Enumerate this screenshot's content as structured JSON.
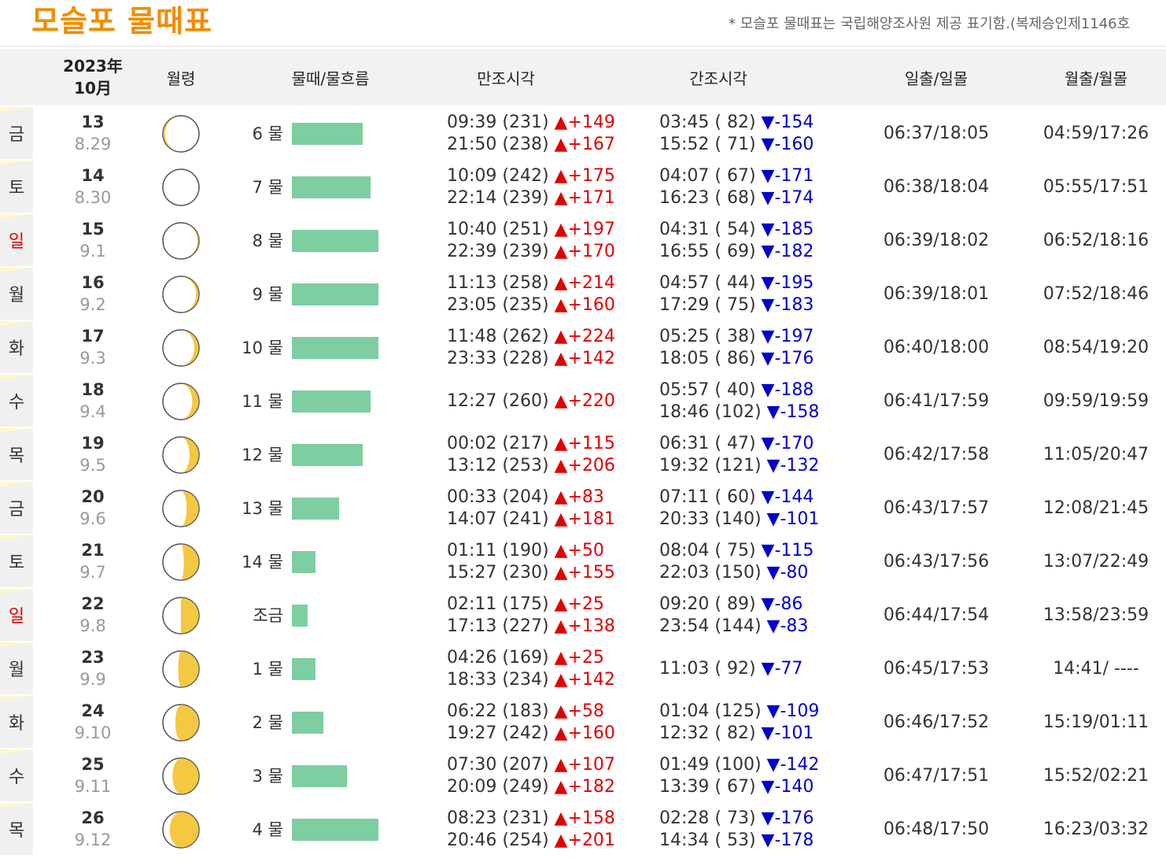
{
  "title": "모슬포 물때표",
  "note": "* 모슬포 물때표는 국립해양조사원 제공 표기함.(복제승인제1146호",
  "header": {
    "year_month": [
      "2023年",
      "10月"
    ],
    "moon_age": "월령",
    "tide": "물때/물흐름",
    "high": "만조시각",
    "low": "간조시각",
    "sun": "일출/일몰",
    "moon": "월출/월몰"
  },
  "colors": {
    "title": "#f28c00",
    "bar": "#7dcea0",
    "high": "#e00000",
    "low": "#0000cc",
    "sunday": "#e00000",
    "moon_lit": "#f5c842"
  },
  "rows": [
    {
      "dow": "금",
      "day": "13",
      "lunar": "8.29",
      "tide": "6 물",
      "flow": 45,
      "lit": 0.05,
      "waxing": false,
      "high": [
        [
          "09:39 (231) ",
          "▲+149"
        ],
        [
          "21:50 (238) ",
          "▲+167"
        ]
      ],
      "low": [
        [
          "03:45 ( 82) ",
          "▼-154"
        ],
        [
          "15:52 ( 71) ",
          "▼-160"
        ]
      ],
      "sun": "06:37/18:05",
      "moonrs": "04:59/17:26"
    },
    {
      "dow": "토",
      "day": "14",
      "lunar": "8.30",
      "tide": "7 물",
      "flow": 50,
      "lit": 0.0,
      "waxing": true,
      "high": [
        [
          "10:09 (242) ",
          "▲+175"
        ],
        [
          "22:14 (239) ",
          "▲+171"
        ]
      ],
      "low": [
        [
          "04:07 ( 67) ",
          "▼-171"
        ],
        [
          "16:23 ( 68) ",
          "▼-174"
        ]
      ],
      "sun": "06:38/18:04",
      "moonrs": "05:55/17:51"
    },
    {
      "dow": "일",
      "day": "15",
      "lunar": "9.1",
      "tide": "8 물",
      "flow": 55,
      "lit": 0.03,
      "waxing": true,
      "sunday": true,
      "high": [
        [
          "10:40 (251) ",
          "▲+197"
        ],
        [
          "22:39 (239) ",
          "▲+170"
        ]
      ],
      "low": [
        [
          "04:31 ( 54) ",
          "▼-185"
        ],
        [
          "16:55 ( 69) ",
          "▼-182"
        ]
      ],
      "sun": "06:39/18:02",
      "moonrs": "06:52/18:16"
    },
    {
      "dow": "월",
      "day": "16",
      "lunar": "9.2",
      "tide": "9 물",
      "flow": 55,
      "lit": 0.07,
      "waxing": true,
      "high": [
        [
          "11:13 (258) ",
          "▲+214"
        ],
        [
          "23:05 (235) ",
          "▲+160"
        ]
      ],
      "low": [
        [
          "04:57 ( 44) ",
          "▼-195"
        ],
        [
          "17:29 ( 75) ",
          "▼-183"
        ]
      ],
      "sun": "06:39/18:01",
      "moonrs": "07:52/18:46"
    },
    {
      "dow": "화",
      "day": "17",
      "lunar": "9.3",
      "tide": "10 물",
      "flow": 55,
      "lit": 0.12,
      "waxing": true,
      "high": [
        [
          "11:48 (262) ",
          "▲+224"
        ],
        [
          "23:33 (228) ",
          "▲+142"
        ]
      ],
      "low": [
        [
          "05:25 ( 38) ",
          "▼-197"
        ],
        [
          "18:05 ( 86) ",
          "▼-176"
        ]
      ],
      "sun": "06:40/18:00",
      "moonrs": "08:54/19:20"
    },
    {
      "dow": "수",
      "day": "18",
      "lunar": "9.4",
      "tide": "11 물",
      "flow": 50,
      "lit": 0.18,
      "waxing": true,
      "high": [
        [
          "12:27 (260) ",
          "▲+220"
        ]
      ],
      "low": [
        [
          "05:57 ( 40) ",
          "▼-188"
        ],
        [
          "18:46 (102) ",
          "▼-158"
        ]
      ],
      "sun": "06:41/17:59",
      "moonrs": "09:59/19:59"
    },
    {
      "dow": "목",
      "day": "19",
      "lunar": "9.5",
      "tide": "12 물",
      "flow": 45,
      "lit": 0.26,
      "waxing": true,
      "high": [
        [
          "00:02 (217) ",
          "▲+115"
        ],
        [
          "13:12 (253) ",
          "▲+206"
        ]
      ],
      "low": [
        [
          "06:31 ( 47) ",
          "▼-170"
        ],
        [
          "19:32 (121) ",
          "▼-132"
        ]
      ],
      "sun": "06:42/17:58",
      "moonrs": "11:05/20:47"
    },
    {
      "dow": "금",
      "day": "20",
      "lunar": "9.6",
      "tide": "13 물",
      "flow": 30,
      "lit": 0.34,
      "waxing": true,
      "high": [
        [
          "00:33 (204) ",
          "▲+83"
        ],
        [
          "14:07 (241) ",
          "▲+181"
        ]
      ],
      "low": [
        [
          "07:11 ( 60) ",
          "▼-144"
        ],
        [
          "20:33 (140) ",
          "▼-101"
        ]
      ],
      "sun": "06:43/17:57",
      "moonrs": "12:08/21:45"
    },
    {
      "dow": "토",
      "day": "21",
      "lunar": "9.7",
      "tide": "14 물",
      "flow": 15,
      "lit": 0.42,
      "waxing": true,
      "high": [
        [
          "01:11 (190) ",
          "▲+50"
        ],
        [
          "15:27 (230) ",
          "▲+155"
        ]
      ],
      "low": [
        [
          "08:04 ( 75) ",
          "▼-115"
        ],
        [
          "22:03 (150) ",
          "▼-80"
        ]
      ],
      "sun": "06:43/17:56",
      "moonrs": "13:07/22:49"
    },
    {
      "dow": "일",
      "day": "22",
      "lunar": "9.8",
      "tide": "조금",
      "flow": 10,
      "lit": 0.5,
      "waxing": true,
      "sunday": true,
      "high": [
        [
          "02:11 (175) ",
          "▲+25"
        ],
        [
          "17:13 (227) ",
          "▲+138"
        ]
      ],
      "low": [
        [
          "09:20 ( 89) ",
          "▼-86"
        ],
        [
          "23:54 (144) ",
          "▼-83"
        ]
      ],
      "sun": "06:44/17:54",
      "moonrs": "13:58/23:59"
    },
    {
      "dow": "월",
      "day": "23",
      "lunar": "9.9",
      "tide": "1 물",
      "flow": 15,
      "lit": 0.58,
      "waxing": true,
      "high": [
        [
          "04:26 (169) ",
          "▲+25"
        ],
        [
          "18:33 (234) ",
          "▲+142"
        ]
      ],
      "low": [
        [
          "11:03 ( 92) ",
          "▼-77"
        ]
      ],
      "sun": "06:45/17:53",
      "moonrs": "14:41/ ----"
    },
    {
      "dow": "화",
      "day": "24",
      "lunar": "9.10",
      "tide": "2 물",
      "flow": 20,
      "lit": 0.66,
      "waxing": true,
      "high": [
        [
          "06:22 (183) ",
          "▲+58"
        ],
        [
          "19:27 (242) ",
          "▲+160"
        ]
      ],
      "low": [
        [
          "01:04 (125) ",
          "▼-109"
        ],
        [
          "12:32 ( 82) ",
          "▼-101"
        ]
      ],
      "sun": "06:46/17:52",
      "moonrs": "15:19/01:11"
    },
    {
      "dow": "수",
      "day": "25",
      "lunar": "9.11",
      "tide": "3 물",
      "flow": 35,
      "lit": 0.74,
      "waxing": true,
      "high": [
        [
          "07:30 (207) ",
          "▲+107"
        ],
        [
          "20:09 (249) ",
          "▲+182"
        ]
      ],
      "low": [
        [
          "01:49 (100) ",
          "▼-142"
        ],
        [
          "13:39 ( 67) ",
          "▼-140"
        ]
      ],
      "sun": "06:47/17:51",
      "moonrs": "15:52/02:21"
    },
    {
      "dow": "목",
      "day": "26",
      "lunar": "9.12",
      "tide": "4 물",
      "flow": 55,
      "lit": 0.82,
      "waxing": true,
      "high": [
        [
          "08:23 (231) ",
          "▲+158"
        ],
        [
          "20:46 (254) ",
          "▲+201"
        ]
      ],
      "low": [
        [
          "02:28 ( 73) ",
          "▼-176"
        ],
        [
          "14:34 ( 53) ",
          "▼-178"
        ]
      ],
      "sun": "06:48/17:50",
      "moonrs": "16:23/03:32"
    }
  ]
}
